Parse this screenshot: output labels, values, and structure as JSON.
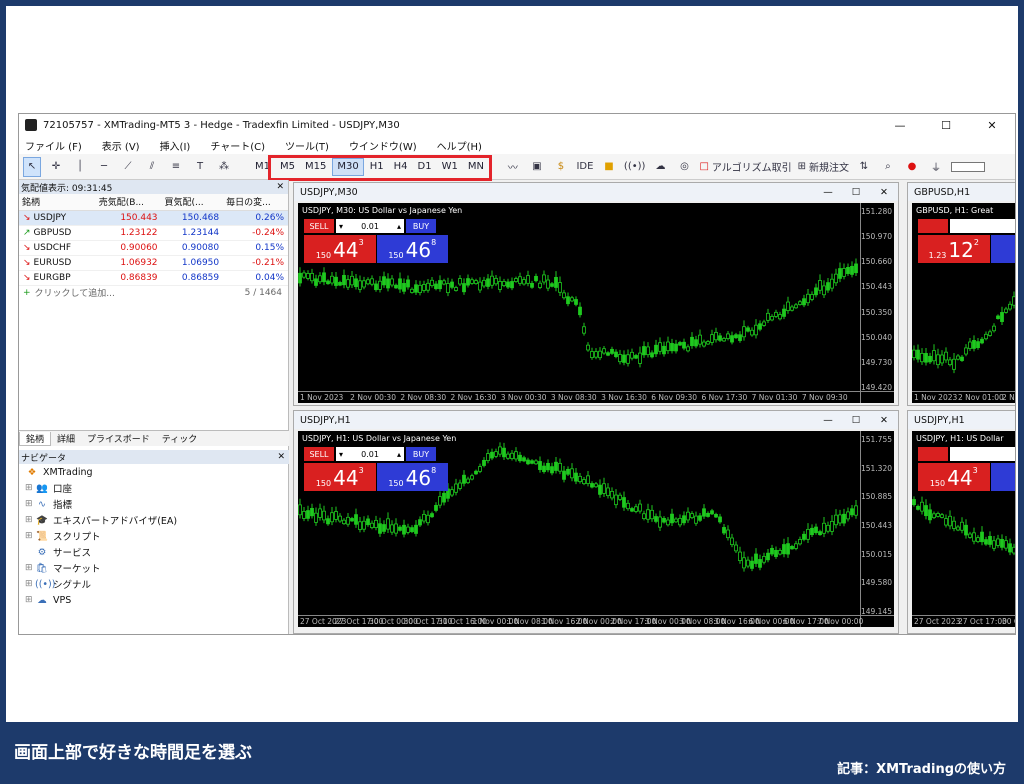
{
  "window": {
    "title": "72105757 - XMTrading-MT5 3 - Hedge - Tradexfin Limited - USDJPY,M30",
    "min": "—",
    "max": "☐",
    "close": "✕"
  },
  "menu": [
    "ファイル (F)",
    "表示 (V)",
    "挿入(I)",
    "チャート(C)",
    "ツール(T)",
    "ウインドウ(W)",
    "ヘルプ(H)"
  ],
  "timeframes": [
    "M1",
    "M5",
    "M15",
    "M30",
    "H1",
    "H4",
    "D1",
    "W1",
    "MN"
  ],
  "active_timeframe": "M30",
  "toolbar": {
    "ide": "IDE",
    "algo": "アルゴリズム取引",
    "new_order": "新規注文"
  },
  "market_watch": {
    "header": "気配値表示: 09:31:45",
    "columns": [
      "銘柄",
      "売気配(B...",
      "買気配(...",
      "毎日の変..."
    ],
    "rows": [
      {
        "symbol": "USDJPY",
        "bid": "150.443",
        "ask": "150.468",
        "change": "0.26%",
        "dir": "down"
      },
      {
        "symbol": "GBPUSD",
        "bid": "1.23122",
        "ask": "1.23144",
        "change": "-0.24%",
        "dir": "up"
      },
      {
        "symbol": "USDCHF",
        "bid": "0.90060",
        "ask": "0.90080",
        "change": "0.15%",
        "dir": "down"
      },
      {
        "symbol": "EURUSD",
        "bid": "1.06932",
        "ask": "1.06950",
        "change": "-0.21%",
        "dir": "down"
      },
      {
        "symbol": "EURGBP",
        "bid": "0.86839",
        "ask": "0.86859",
        "change": "0.04%",
        "dir": "down"
      }
    ],
    "add": "クリックして追加...",
    "count": "5 / 1464"
  },
  "tabs": [
    "銘柄",
    "詳細",
    "プライスボード",
    "ティック"
  ],
  "navigator": {
    "header": "ナビゲータ",
    "root": "XMTrading",
    "items": [
      "口座",
      "指標",
      "エキスパートアドバイザ(EA)",
      "スクリプト",
      "サービス",
      "マーケット",
      "シグナル",
      "VPS"
    ]
  },
  "charts": [
    {
      "tab": "USDJPY,M30",
      "title": "USDJPY, M30:  US Dollar vs Japanese Yen",
      "sell": "SELL",
      "buy": "BUY",
      "lot": "0.01",
      "bid_pre": "150",
      "bid_big": "44",
      "bid_sup": "3",
      "ask_pre": "150",
      "ask_big": "46",
      "ask_sup": "8",
      "y": [
        "151.280",
        "150.970",
        "150.660",
        "150.443",
        "150.350",
        "150.040",
        "149.730",
        "149.420"
      ],
      "x": [
        "1 Nov 2023",
        "2 Nov 00:30",
        "2 Nov 08:30",
        "2 Nov 16:30",
        "3 Nov 00:30",
        "3 Nov 08:30",
        "3 Nov 16:30",
        "6 Nov 09:30",
        "6 Nov 17:30",
        "7 Nov 01:30",
        "7 Nov 09:30"
      ]
    },
    {
      "tab": "USDJPY,H1",
      "title": "USDJPY, H1:  US Dollar vs Japanese Yen",
      "sell": "SELL",
      "buy": "BUY",
      "lot": "0.01",
      "bid_pre": "150",
      "bid_big": "44",
      "bid_sup": "3",
      "ask_pre": "150",
      "ask_big": "46",
      "ask_sup": "8",
      "y": [
        "151.755",
        "151.320",
        "150.885",
        "150.443",
        "150.015",
        "149.580",
        "149.145"
      ],
      "x": [
        "27 Oct 2023",
        "27 Oct 17:00",
        "30 Oct 00:00",
        "30 Oct 17:00",
        "31 Oct 16:00",
        "1 Nov 00:00",
        "1 Nov 08:00",
        "1 Nov 16:00",
        "2 Nov 00:00",
        "2 Nov 17:00",
        "3 Nov 00:00",
        "3 Nov 08:00",
        "3 Nov 16:00",
        "6 Nov 00:00",
        "6 Nov 17:00",
        "7 Nov 00:00"
      ]
    },
    {
      "tab": "GBPUSD,H1",
      "title": "GBPUSD, H1:  Great",
      "bid_pre": "1.23",
      "bid_big": "12",
      "bid_sup": "2",
      "ask_pre": "1.23",
      "x": [
        "1 Nov 2023",
        "2 Nov 01:00",
        "2 Nov"
      ]
    },
    {
      "tab": "USDJPY,H1",
      "title": "USDJPY, H1:  US Dollar",
      "bid_pre": "150",
      "bid_big": "44",
      "bid_sup": "3",
      "x": [
        "27 Oct 2023",
        "27 Oct 17:00",
        "30 Oct"
      ]
    }
  ],
  "caption": "画面上部で好きな時間足を選ぶ",
  "credit": "記事：XMTradingの使い方"
}
